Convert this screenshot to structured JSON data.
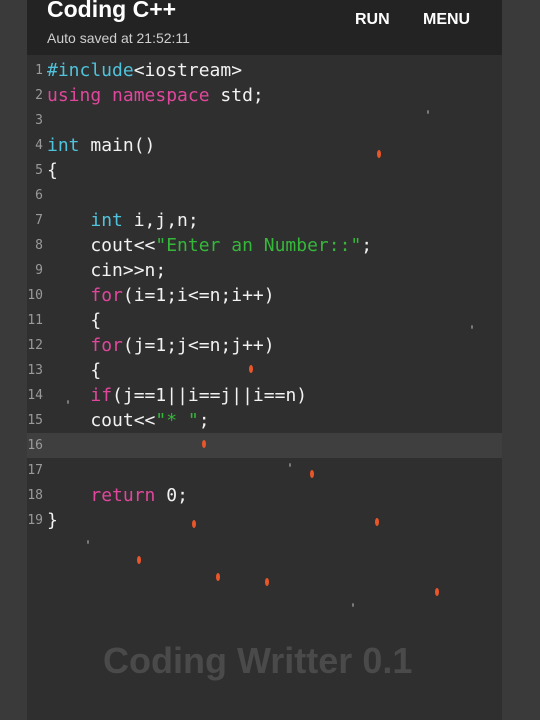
{
  "app": {
    "title": "Coding C++",
    "autosave": "Auto saved at 21:52:11",
    "run_label": "RUN",
    "menu_label": "MENU",
    "watermark": "Coding Writter 0.1"
  },
  "editor": {
    "active_line": 16,
    "lines": [
      {
        "n": "1",
        "t": "#include<iostream>"
      },
      {
        "n": "2",
        "t": "using namespace std;"
      },
      {
        "n": "3",
        "t": ""
      },
      {
        "n": "4",
        "t": "int main()"
      },
      {
        "n": "5",
        "t": "{"
      },
      {
        "n": "6",
        "t": ""
      },
      {
        "n": "7",
        "t": "    int i,j,n;"
      },
      {
        "n": "8",
        "t": "    cout<<\"Enter an Number::\";"
      },
      {
        "n": "9",
        "t": "    cin>>n;"
      },
      {
        "n": "10",
        "t": "    for(i=1;i<=n;i++)"
      },
      {
        "n": "11",
        "t": "    {"
      },
      {
        "n": "12",
        "t": "    for(j=1;j<=n;j++)"
      },
      {
        "n": "13",
        "t": "    {"
      },
      {
        "n": "14",
        "t": "    if(j==1||i==j||i==n)"
      },
      {
        "n": "15",
        "t": "    cout<<\"* \";"
      },
      {
        "n": "16",
        "t": ""
      },
      {
        "n": "17",
        "t": ""
      },
      {
        "n": "18",
        "t": "    return 0;"
      },
      {
        "n": "19",
        "t": "}"
      }
    ]
  },
  "colors": {
    "keyword_blue": "#4fc3dc",
    "keyword_pink": "#e0479c",
    "string_green": "#35b83a"
  }
}
